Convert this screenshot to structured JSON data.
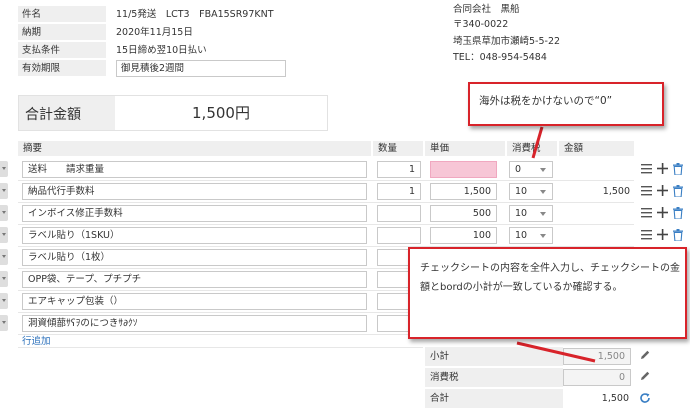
{
  "header": {
    "fields": [
      {
        "label": "件名",
        "value": "11/5発送　LCT3　FBA15SR97KNT"
      },
      {
        "label": "納期",
        "value": "2020年11月15日"
      },
      {
        "label": "支払条件",
        "value": "15日締め翌10日払い"
      },
      {
        "label": "有効期限",
        "value": "御見積後2週間"
      }
    ],
    "address": [
      "合同会社　黒船",
      "〒340-0022",
      "埼玉県草加市瀬崎5-5-22",
      "TEL：048-954-5484"
    ]
  },
  "total": {
    "label": "合計金額",
    "value": "1,500円"
  },
  "columns": {
    "description": "摘要",
    "qty": "数量",
    "unit_price": "単価",
    "tax": "消費税",
    "amount": "金額"
  },
  "rows": [
    {
      "desc": "送料　　請求重量",
      "qty": "1",
      "price": "",
      "tax": "0",
      "amount": ""
    },
    {
      "desc": "納品代行手数料",
      "qty": "1",
      "price": "1,500",
      "tax": "10",
      "amount": "1,500"
    },
    {
      "desc": "インボイス修正手数料",
      "qty": "",
      "price": "500",
      "tax": "10",
      "amount": ""
    },
    {
      "desc": "ラベル貼り（1SKU）",
      "qty": "",
      "price": "100",
      "tax": "10",
      "amount": ""
    },
    {
      "desc": "ラベル貼り（1枚）",
      "qty": "",
      "price": "",
      "tax": "",
      "amount": ""
    },
    {
      "desc": "OPP袋、テープ、プチプチ",
      "qty": "",
      "price": "",
      "tax": "",
      "amount": ""
    },
    {
      "desc": "エアキャップ包装（）",
      "qty": "",
      "price": "",
      "tax": "",
      "amount": ""
    },
    {
      "desc": "洞資傾蔀ｻʕｦのにつきｻ∂ｸｿ",
      "qty": "",
      "price": "",
      "tax": "",
      "amount": ""
    }
  ],
  "add_row_label": "行追加",
  "summary": {
    "subtotal_label": "小計",
    "subtotal_value": "1,500",
    "tax_label": "消費税",
    "tax_value": "0",
    "total_label": "合計",
    "total_value": "1,500"
  },
  "callouts": {
    "top": "海外は税をかけないので“0”",
    "bottom": "チェックシートの内容を全件入力し、チェックシートの金額とbordの小計が一致しているか確認する。"
  },
  "colors": {
    "accent_red": "#d8232a",
    "highlight_pink": "#f7c6d6",
    "link_blue": "#2a6fba",
    "label_gray": "#efefef"
  },
  "icons": [
    "menu-icon",
    "plus-icon",
    "trash-icon",
    "pencil-icon",
    "refresh-icon",
    "chevron-down-icon"
  ]
}
